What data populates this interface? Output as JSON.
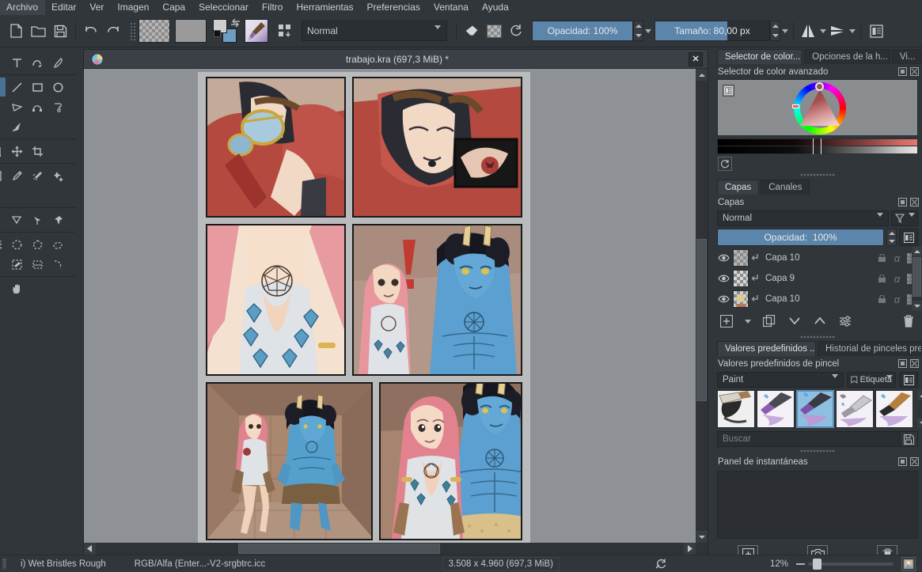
{
  "app": {
    "title": "Krita",
    "accent": "#5b85ab",
    "bg": "#31363b",
    "panel_bg": "#2b2f34",
    "text": "#c8cbcd"
  },
  "menubar": {
    "items": [
      {
        "label": "Archivo",
        "mnemonic": "A"
      },
      {
        "label": "Editar",
        "mnemonic": "E"
      },
      {
        "label": "Ver",
        "mnemonic": "V"
      },
      {
        "label": "Imagen",
        "mnemonic": "I"
      },
      {
        "label": "Capa",
        "mnemonic": "C"
      },
      {
        "label": "Seleccionar",
        "mnemonic": "S"
      },
      {
        "label": "Filtro",
        "mnemonic": "r"
      },
      {
        "label": "Herramientas",
        "mnemonic": "t"
      },
      {
        "label": "Preferencias",
        "mnemonic": "f"
      },
      {
        "label": "Ventana",
        "mnemonic": "V"
      },
      {
        "label": "Ayuda",
        "mnemonic": "y"
      }
    ]
  },
  "toolbar": {
    "new_label": "Nuevo",
    "open_label": "Abrir",
    "save_label": "Guardar",
    "undo_label": "Deshacer",
    "redo_label": "Rehacer",
    "gradient_label": "Gradiente",
    "pattern_label": "Patrón",
    "fgbg_label": "Color de frente y de fondo",
    "brush_preset_label": "Valor predefinido de pincel",
    "workspace_label": "Espacio de trabajo",
    "blend_mode": "Normal",
    "eraser_label": "Borrador",
    "alpha_label": "Preservar alfa",
    "reset_label": "Restablecer",
    "opacity": {
      "label": "Opacidad:",
      "value": "100%",
      "fill_percent": 100
    },
    "size": {
      "label": "Tamaño:",
      "value": "80,00 px",
      "fill_percent": 63
    },
    "mirror_h_label": "Reflejo horizontal",
    "mirror_v_label": "Reflejo vertical",
    "choose_workspace_label": "Elegir espacio de trabajo"
  },
  "toolbox": {
    "tools": [
      {
        "name": "shape-select-tool",
        "glyph": "◄",
        "selected": false
      },
      {
        "name": "text-tool",
        "glyph": "T",
        "selected": false
      },
      {
        "name": "edit-shapes-tool",
        "glyph": "↰",
        "selected": false
      },
      {
        "name": "calligraphy-tool",
        "glyph": "✎",
        "selected": false
      },
      {
        "name": "freehand-brush-tool",
        "glyph": "✏",
        "selected": true
      },
      {
        "name": "line-tool",
        "glyph": "╱",
        "selected": false
      },
      {
        "name": "rectangle-tool",
        "glyph": "▢",
        "selected": false
      },
      {
        "name": "ellipse-tool",
        "glyph": "◯",
        "selected": false
      },
      {
        "name": "polygon-tool",
        "glyph": "⬠",
        "selected": false
      },
      {
        "name": "polyline-tool",
        "glyph": "⟁",
        "selected": false
      },
      {
        "name": "bezier-curve-tool",
        "glyph": "⌒",
        "selected": false
      },
      {
        "name": "freehand-path-tool",
        "glyph": "ᒥ",
        "selected": false
      },
      {
        "name": "dynamic-brush-tool",
        "glyph": "◠",
        "selected": false
      },
      {
        "name": "multibrush-tool",
        "glyph": "➶",
        "selected": false
      },
      {
        "name": "transform-tool",
        "glyph": "⌗",
        "selected": false
      },
      {
        "name": "move-tool",
        "glyph": "✛",
        "selected": false
      },
      {
        "name": "crop-tool",
        "glyph": "⌗",
        "selected": false
      },
      {
        "name": "gradient-tool",
        "glyph": "▤",
        "selected": false
      },
      {
        "name": "color-picker-tool",
        "glyph": "⚲",
        "selected": false
      },
      {
        "name": "colorize-mask-tool",
        "glyph": "✸",
        "selected": false
      },
      {
        "name": "smart-patch-tool",
        "glyph": "✦",
        "selected": false
      },
      {
        "name": "assistant-tool",
        "glyph": "◡",
        "selected": false
      },
      {
        "name": "measure-tool",
        "glyph": "◣",
        "selected": false
      },
      {
        "name": "reference-images-tool",
        "glyph": "◺",
        "selected": false
      },
      {
        "name": "pan-pin-tool",
        "glyph": "📌",
        "selected": false
      },
      {
        "name": "rectangular-select-tool",
        "glyph": "▯",
        "selected": false
      },
      {
        "name": "elliptical-select-tool",
        "glyph": "◌",
        "selected": false
      },
      {
        "name": "polygonal-select-tool",
        "glyph": "⬡",
        "selected": false
      },
      {
        "name": "freehand-select-tool",
        "glyph": "◞",
        "selected": false
      },
      {
        "name": "contiguous-select-tool",
        "glyph": "◤",
        "selected": false
      },
      {
        "name": "similar-color-select-tool",
        "glyph": "⚟",
        "selected": false
      },
      {
        "name": "bezier-select-tool",
        "glyph": "⬚",
        "selected": false
      },
      {
        "name": "magnetic-select-tool",
        "glyph": "◝",
        "selected": false
      },
      {
        "name": "zoom-tool",
        "glyph": "◔",
        "selected": false
      },
      {
        "name": "pan-tool",
        "glyph": "✋",
        "selected": false
      }
    ]
  },
  "document": {
    "title": "trabajo.kra (697,3 MiB) *",
    "close_label": "✕",
    "artwork_description": "Página de cómic con seis viñetas ilustradas"
  },
  "color_selector": {
    "tabs": [
      {
        "label": "Selector de color...",
        "active": true
      },
      {
        "label": "Opciones de la h...",
        "active": false
      },
      {
        "label": "Vi...",
        "active": false
      }
    ],
    "title": "Selector de color avanzado",
    "float_label": "Flotar",
    "close_label": "Cerrar",
    "settings_icon": "settings-list-icon",
    "reset_icon": "reset-color-icon"
  },
  "layers": {
    "tabs": [
      {
        "label": "Capas",
        "active": true
      },
      {
        "label": "Canales",
        "active": false
      }
    ],
    "title": "Capas",
    "blend_mode": "Normal",
    "filter_label": "Filtro",
    "opacity": {
      "label": "Opacidad:",
      "value": "100%",
      "fill_percent": 100
    },
    "rows": [
      {
        "name": "Capa 10",
        "visible": true,
        "thumb": "transparent"
      },
      {
        "name": "Capa 9",
        "visible": true,
        "thumb": "speckles"
      },
      {
        "name": "Capa 10",
        "visible": true,
        "thumb": "artwork"
      }
    ],
    "buttons": [
      {
        "name": "add-layer-button",
        "label": "Añadir capa"
      },
      {
        "name": "duplicate-layer-button",
        "label": "Duplicar capa"
      },
      {
        "name": "move-layer-down-button",
        "label": "Bajar capa"
      },
      {
        "name": "move-layer-up-button",
        "label": "Subir capa"
      },
      {
        "name": "layer-properties-button",
        "label": "Propiedades de la capa"
      },
      {
        "name": "delete-layer-button",
        "label": "Eliminar capa"
      }
    ]
  },
  "brush_presets": {
    "tabs": [
      {
        "label": "Valores predefinidos ...",
        "active": true
      },
      {
        "label": "Historial de pinceles pre...",
        "active": false
      }
    ],
    "title": "Valores predefinidos de pincel",
    "group": "Paint",
    "tag_label": "Etiqueta",
    "search_placeholder": "Buscar",
    "items": [
      {
        "name": "bristles-rough-preset",
        "selected": false
      },
      {
        "name": "wet-bristles-preset",
        "selected": false
      },
      {
        "name": "wet-bristles-rough-preset",
        "selected": true
      },
      {
        "name": "palette-knife-preset",
        "selected": false
      },
      {
        "name": "wet-brush-preset",
        "selected": false
      }
    ]
  },
  "snapshot": {
    "title": "Panel de instantáneas",
    "buttons": [
      {
        "name": "add-snapshot-button",
        "label": "Añadir"
      },
      {
        "name": "capture-snapshot-button",
        "label": "Capturar"
      },
      {
        "name": "delete-snapshot-button",
        "label": "Eliminar"
      }
    ]
  },
  "statusbar": {
    "brush_preset": "i) Wet Bristles Rough",
    "color_profile": "RGB/Alfa (Enter...-V2-srgbtrc.icc",
    "dimensions": "3.508 x 4.960 (697,3 MiB)",
    "selection_icon": "no-selection-icon",
    "zoom_level": "12%",
    "zoom_slider_percent": 10,
    "fit_page_label": "Ajustar a la página"
  }
}
